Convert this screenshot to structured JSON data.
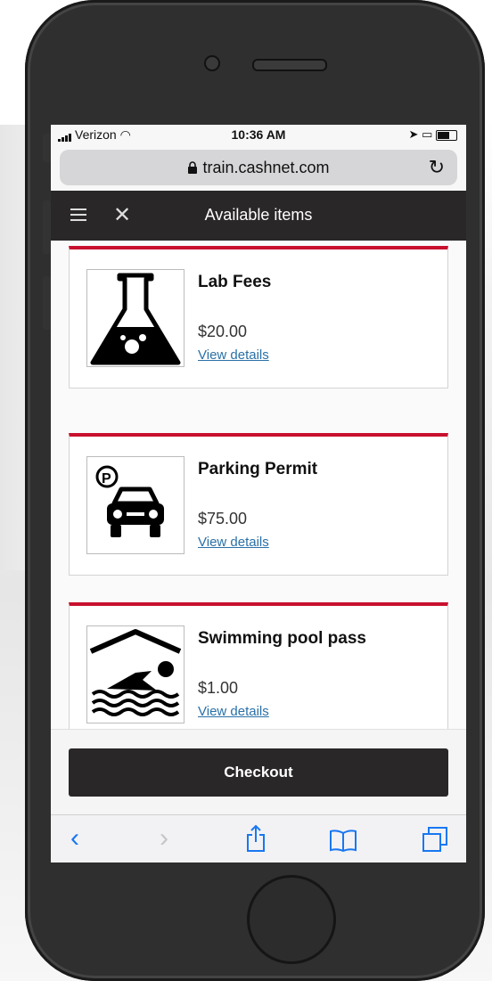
{
  "status_bar": {
    "carrier": "Verizon",
    "time": "10:36 AM"
  },
  "browser": {
    "url": "train.cashnet.com"
  },
  "app_bar": {
    "title": "Available items"
  },
  "items": [
    {
      "name": "Lab Fees",
      "price": "$20.00",
      "link": "View details",
      "icon": "flask-icon"
    },
    {
      "name": "Parking Permit",
      "price": "$75.00",
      "link": "View details",
      "icon": "parking-car-icon"
    },
    {
      "name": "Swimming pool pass",
      "price": "$1.00",
      "link": "View details",
      "icon": "swimmer-icon"
    }
  ],
  "checkout": {
    "label": "Checkout"
  },
  "colors": {
    "accent": "#c8102e",
    "dark": "#2a2728",
    "link": "#2a70a8",
    "ios_blue": "#1877f2"
  }
}
